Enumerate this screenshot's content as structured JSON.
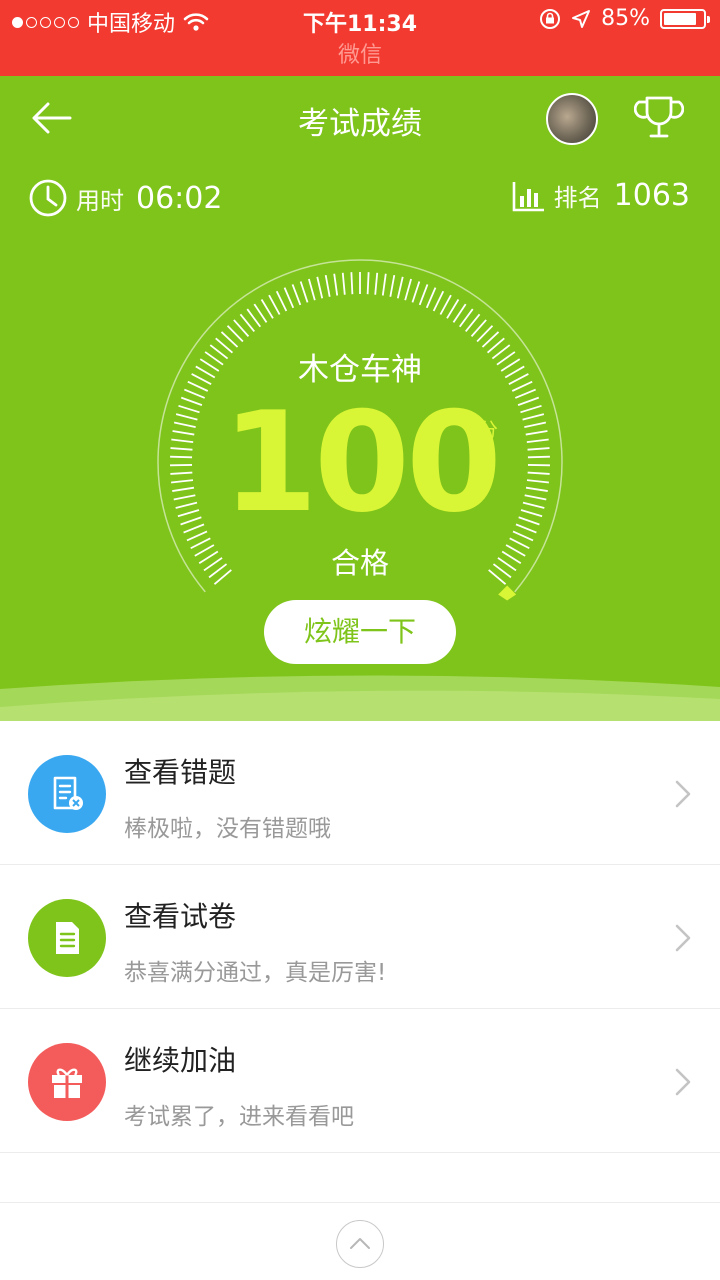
{
  "status_bar": {
    "carrier": "中国移动",
    "time": "下午11:34",
    "battery": "85%",
    "battery_level": 0.85,
    "signal_bars_filled": 1,
    "signal_bars_total": 5
  },
  "wechat_label": "微信",
  "header": {
    "title": "考试成绩",
    "time_label": "用时",
    "time_value": "06:02",
    "rank_label": "排名",
    "rank_value": "1063"
  },
  "score": {
    "nickname": "木仓车神",
    "value": "100",
    "unit": "分",
    "result": "合格",
    "share_label": "炫耀一下"
  },
  "menu": {
    "items": [
      {
        "title": "查看错题",
        "subtitle": "棒极啦，没有错题哦",
        "color": "#3aa8f0",
        "icon": "wrong-question-icon"
      },
      {
        "title": "查看试卷",
        "subtitle": "恭喜满分通过，真是厉害!",
        "color": "#7fc41a",
        "icon": "paper-document-icon"
      },
      {
        "title": "继续加油",
        "subtitle": "考试累了，进来看看吧",
        "color": "#f45b5b",
        "icon": "gift-icon"
      }
    ]
  },
  "colors": {
    "status_red": "#f23a30",
    "hero_green": "#7fc41a",
    "score_yellow": "#d8f536"
  }
}
